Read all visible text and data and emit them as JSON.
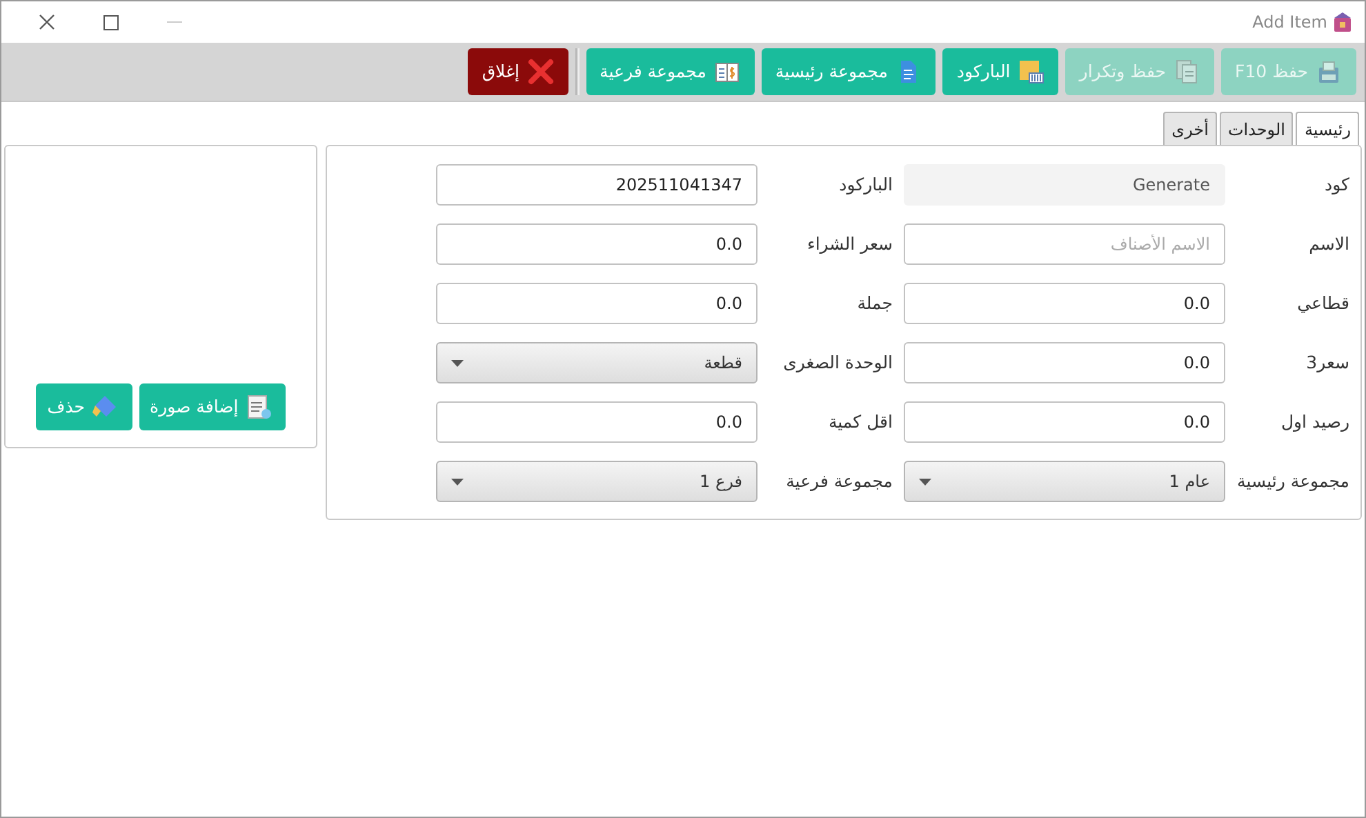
{
  "window": {
    "title": "Add Item"
  },
  "toolbar": [
    {
      "label": "حفظ F10",
      "disabled": true,
      "kind": "normal"
    },
    {
      "label": "حفظ وتكرار",
      "disabled": true,
      "kind": "normal"
    },
    {
      "label": "الباركود",
      "disabled": false,
      "kind": "normal"
    },
    {
      "label": "مجموعة رئيسية",
      "disabled": false,
      "kind": "normal"
    },
    {
      "label": "مجموعة فرعية",
      "disabled": false,
      "kind": "normal"
    },
    {
      "label": "إغلاق",
      "disabled": false,
      "kind": "danger"
    }
  ],
  "tabs": [
    {
      "label": "رئيسية",
      "selected": true
    },
    {
      "label": "الوحدات",
      "selected": false
    },
    {
      "label": "أخرى",
      "selected": false
    }
  ],
  "fields": [
    {
      "label": "كود",
      "kind": "readonly",
      "value": "Generate"
    },
    {
      "label": "الباركود",
      "kind": "text",
      "value": "202511041347"
    },
    {
      "label": "الاسم",
      "kind": "text",
      "placeholder": "الاسم الأصناف"
    },
    {
      "label": "سعر الشراء",
      "kind": "text",
      "value": "0.0"
    },
    {
      "label": "قطاعي",
      "kind": "text",
      "value": "0.0"
    },
    {
      "label": "جملة",
      "kind": "text",
      "value": "0.0"
    },
    {
      "label": "سعر3",
      "kind": "text",
      "value": "0.0"
    },
    {
      "label": "الوحدة الصغرى",
      "kind": "select",
      "value": "قطعة"
    },
    {
      "label": "رصيد اول",
      "kind": "text",
      "value": "0.0"
    },
    {
      "label": "اقل كمية",
      "kind": "text",
      "value": "0.0"
    },
    {
      "label": "مجموعة رئيسية",
      "kind": "select",
      "value": "عام 1"
    },
    {
      "label": "مجموعة فرعية",
      "kind": "select",
      "value": "فرع 1"
    }
  ],
  "image_panel": {
    "buttons": [
      {
        "label": "إضافة صورة"
      },
      {
        "label": "حذف"
      }
    ]
  }
}
